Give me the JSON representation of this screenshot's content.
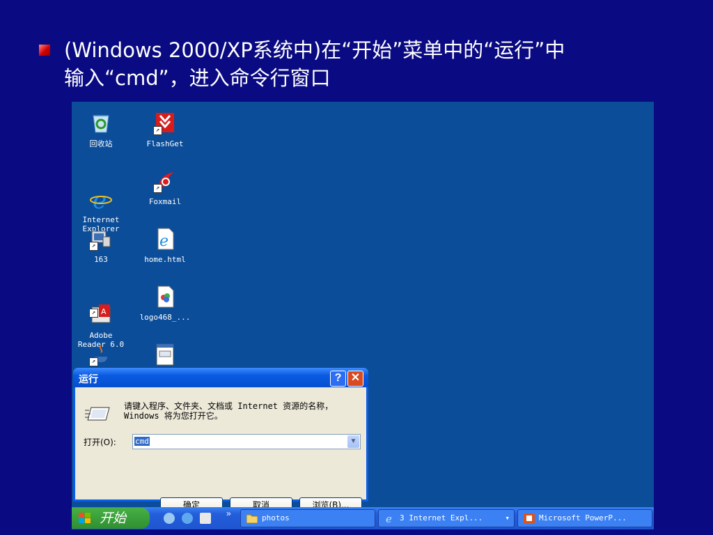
{
  "slide": {
    "line1": "(Windows 2000/XP系统中)在“开始”菜单中的“运行”中",
    "line2": "输入“cmd”，进入命令行窗口"
  },
  "desktop": {
    "icons": [
      {
        "label": "回收站",
        "icon": "recycle-bin-icon"
      },
      {
        "label": "FlashGet",
        "icon": "flashget-icon"
      },
      {
        "label": "Internet\nExplorer",
        "icon": "internet-explorer-icon"
      },
      {
        "label": "Foxmail",
        "icon": "foxmail-icon"
      },
      {
        "label": "163",
        "icon": "network-computer-icon"
      },
      {
        "label": "home.html",
        "icon": "html-file-icon"
      },
      {
        "label": "Adobe\nReader 6.0",
        "icon": "adobe-reader-icon"
      },
      {
        "label": "logo468_...",
        "icon": "image-file-icon"
      }
    ]
  },
  "run_dialog": {
    "title": "运行",
    "help": "?",
    "close": "✕",
    "description": "请键入程序、文件夹、文档或 Internet 资源的名称，Windows 将为您打开它。",
    "open_label": "打开(O):",
    "open_value": "cmd",
    "ok": "确定",
    "cancel": "取消",
    "browse": "浏览(B)..."
  },
  "taskbar": {
    "start_label": "开始",
    "more": "»",
    "tasks": [
      {
        "label": "photos"
      },
      {
        "label": "3 Internet Expl...",
        "menu": "▾"
      },
      {
        "label": "Microsoft PowerP..."
      }
    ]
  },
  "colors": {
    "slide_bg": "#0a0a82",
    "desktop_bg": "#0b4d99",
    "xp_blue": "#245edb",
    "start_green": "#2f8f2f"
  }
}
